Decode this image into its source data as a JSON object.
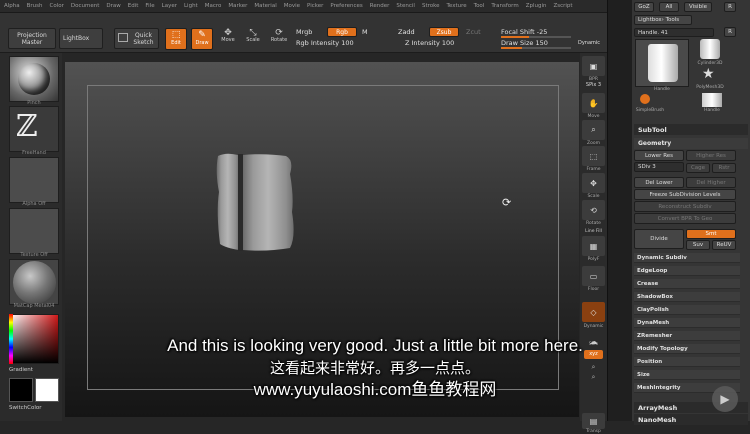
{
  "menu": [
    "Alpha",
    "Brush",
    "Color",
    "Document",
    "Draw",
    "Edit",
    "File",
    "Layer",
    "Light",
    "Macro",
    "Marker",
    "Material",
    "Movie",
    "Picker",
    "Preferences",
    "Render",
    "Stencil",
    "Stroke",
    "Texture",
    "Tool",
    "Transform",
    "Zplugin",
    "Zscript"
  ],
  "toolbar": {
    "projection_master": "Projection Master",
    "lightbox": "LightBox",
    "quick_sketch": "Quick Sketch",
    "edit": "Edit",
    "draw": "Draw",
    "move": "Move",
    "scale": "Scale",
    "rotate": "Rotate",
    "mrgb": "Mrgb",
    "rgb": "Rgb",
    "m": "M",
    "rgb_intensity": "Rgb Intensity 100",
    "zadd": "Zadd",
    "zsub": "Zsub",
    "zcut": "Zcut",
    "z_intensity": "Z Intensity 100",
    "focal_shift": "Focal Shift -25",
    "draw_size": "Draw Size 150",
    "dynamic": "Dynamic",
    "draw_size_fill": 0.3,
    "focal_shift_fill": 0.4
  },
  "left_shelf": {
    "brush_label": "Pinch",
    "stroke_label": "FreeHand",
    "alpha_label": "Alpha Off",
    "texture_label": "Texture Off",
    "material_label": "MatCap Metal04",
    "gradient_label": "Gradient",
    "switch_color_label": "SwitchColor"
  },
  "right_shelf": {
    "bpr": "BPR",
    "spix": "SPix 3",
    "move": "Move",
    "scroll": "Scroll",
    "zoom": "Zoom",
    "actual": "Actual",
    "frame": "Frame",
    "scale": "Scale",
    "rotate": "Rotate",
    "line_fill": "Line Fill",
    "polyf": "PolyF",
    "floor": "Floor",
    "transp": "Transp",
    "dynamic": "Dynamic",
    "solo": "Solo",
    "xyz": "xyz"
  },
  "right_panel": {
    "goz": "GoZ",
    "all": "All",
    "visible": "Visible",
    "r": "R",
    "lightbox_tools": "Lightbox› Tools",
    "handle_label": "Handle. 41",
    "r2": "R",
    "tool_current": "Handle",
    "tool_cylinder": "Cylinder3D",
    "tool_polymesh": "PolyMesh3D",
    "tool_simplebrush": "SimpleBrush",
    "tool_handle": "Handle",
    "subtool": "SubTool",
    "geometry": "Geometry",
    "lower_res": "Lower Res",
    "higher_res": "Higher Res",
    "sdiv": "SDiv 3",
    "cage": "Cage",
    "rstr": "Rstr",
    "del_lower": "Del Lower",
    "del_higher": "Del Higher",
    "freeze_subdivision": "Freeze SubDivision Levels",
    "reconstruct_subdiv": "Reconstruct Subdiv",
    "convert_bpr": "Convert BPR To Geo",
    "divide": "Divide",
    "smt": "Smt",
    "suv": "Suv",
    "reuv": "ReUV",
    "items": [
      "Dynamic Subdiv",
      "EdgeLoop",
      "Crease",
      "ShadowBox",
      "ClayPolish",
      "DynaMesh",
      "ZRemesher",
      "Modify Topology",
      "Position",
      "Size",
      "MeshIntegrity"
    ],
    "arraymesh": "ArrayMesh",
    "nanomesh": "NanoMesh"
  },
  "subtitles": {
    "english": "And this is looking very good. Just a little bit more here.",
    "chinese": "这看起来非常好。再多一点点。",
    "watermark": "www.yuyulaoshi.com鱼鱼教程网"
  },
  "colors": {
    "accent": "#e0701c",
    "panel": "#353535",
    "canvas_top": "#525252",
    "canvas_bottom": "#151515"
  }
}
